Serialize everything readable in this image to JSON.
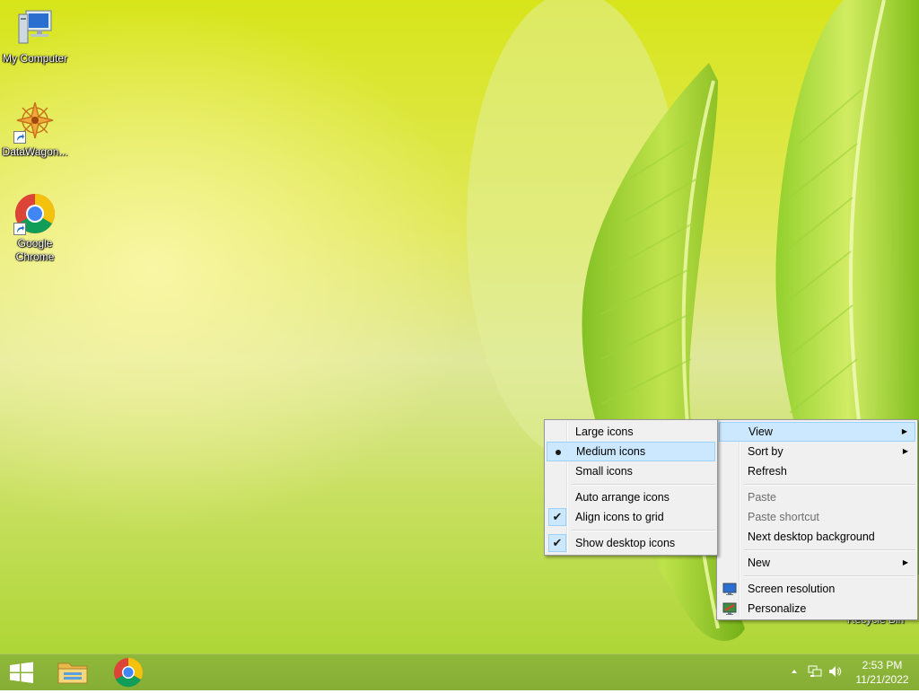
{
  "desktop": {
    "icons": [
      {
        "label": "My Computer",
        "icon": "computer-icon"
      },
      {
        "label": "DataWagon...",
        "icon": "datawagon-icon"
      },
      {
        "label": "Google Chrome",
        "icon": "chrome-icon"
      }
    ],
    "recycle_bin_partial_label": "Recycle Bin"
  },
  "context_menu": {
    "items": [
      {
        "label": "View",
        "has_submenu": true,
        "highlighted": true
      },
      {
        "label": "Sort by",
        "has_submenu": true
      },
      {
        "label": "Refresh"
      },
      {
        "label": "Paste",
        "disabled": true
      },
      {
        "label": "Paste shortcut",
        "disabled": true
      },
      {
        "label": "Next desktop background"
      },
      {
        "label": "New",
        "has_submenu": true
      },
      {
        "label": "Screen resolution",
        "icon": "screen-resolution-icon"
      },
      {
        "label": "Personalize",
        "icon": "personalize-icon"
      }
    ]
  },
  "view_submenu": {
    "items": [
      {
        "label": "Large icons"
      },
      {
        "label": "Medium icons",
        "selected": true,
        "highlighted": true
      },
      {
        "label": "Small icons"
      },
      {
        "label": "Auto arrange icons"
      },
      {
        "label": "Align icons to grid",
        "checked": true
      },
      {
        "label": "Show desktop icons",
        "checked": true
      }
    ]
  },
  "taskbar": {
    "buttons": [
      {
        "name": "start",
        "icon": "windows-logo-icon"
      },
      {
        "name": "file-explorer",
        "icon": "folder-icon"
      },
      {
        "name": "chrome",
        "icon": "chrome-icon"
      }
    ],
    "tray": {
      "clock_time": "2:53 PM",
      "clock_date": "11/21/2022"
    }
  },
  "colors": {
    "menu_bg": "#f0f0f0",
    "menu_highlight": "#cce8ff",
    "taskbar": "#8ab537"
  }
}
